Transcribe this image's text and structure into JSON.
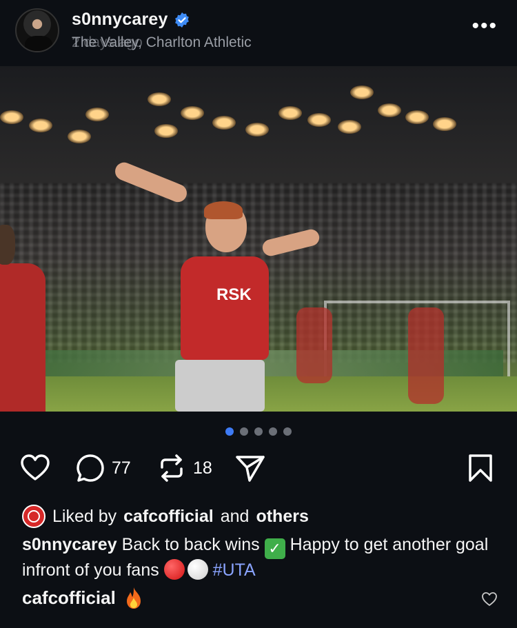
{
  "post": {
    "username": "s0nnycarey",
    "location": "The Valley, Charlton Athletic",
    "location_overlap": "2 days ago",
    "more_label": "•••"
  },
  "carousel": {
    "page_count": 5,
    "active_index": 0
  },
  "actions": {
    "comment_count": "77",
    "repost_count": "18"
  },
  "likes": {
    "prefix": "Liked by",
    "user": "cafcofficial",
    "middle": "and",
    "suffix": "others"
  },
  "caption": {
    "username": "s0nnycarey",
    "text1": "Back to back wins",
    "text2": "Happy to get another goal infront of you fans",
    "hashtag": "#UTA"
  },
  "top_comment": {
    "username": "cafcofficial"
  },
  "colors": {
    "accent": "#3e7bf5",
    "hashtag": "#8aa4ff",
    "verified": "#3e8bf5"
  }
}
